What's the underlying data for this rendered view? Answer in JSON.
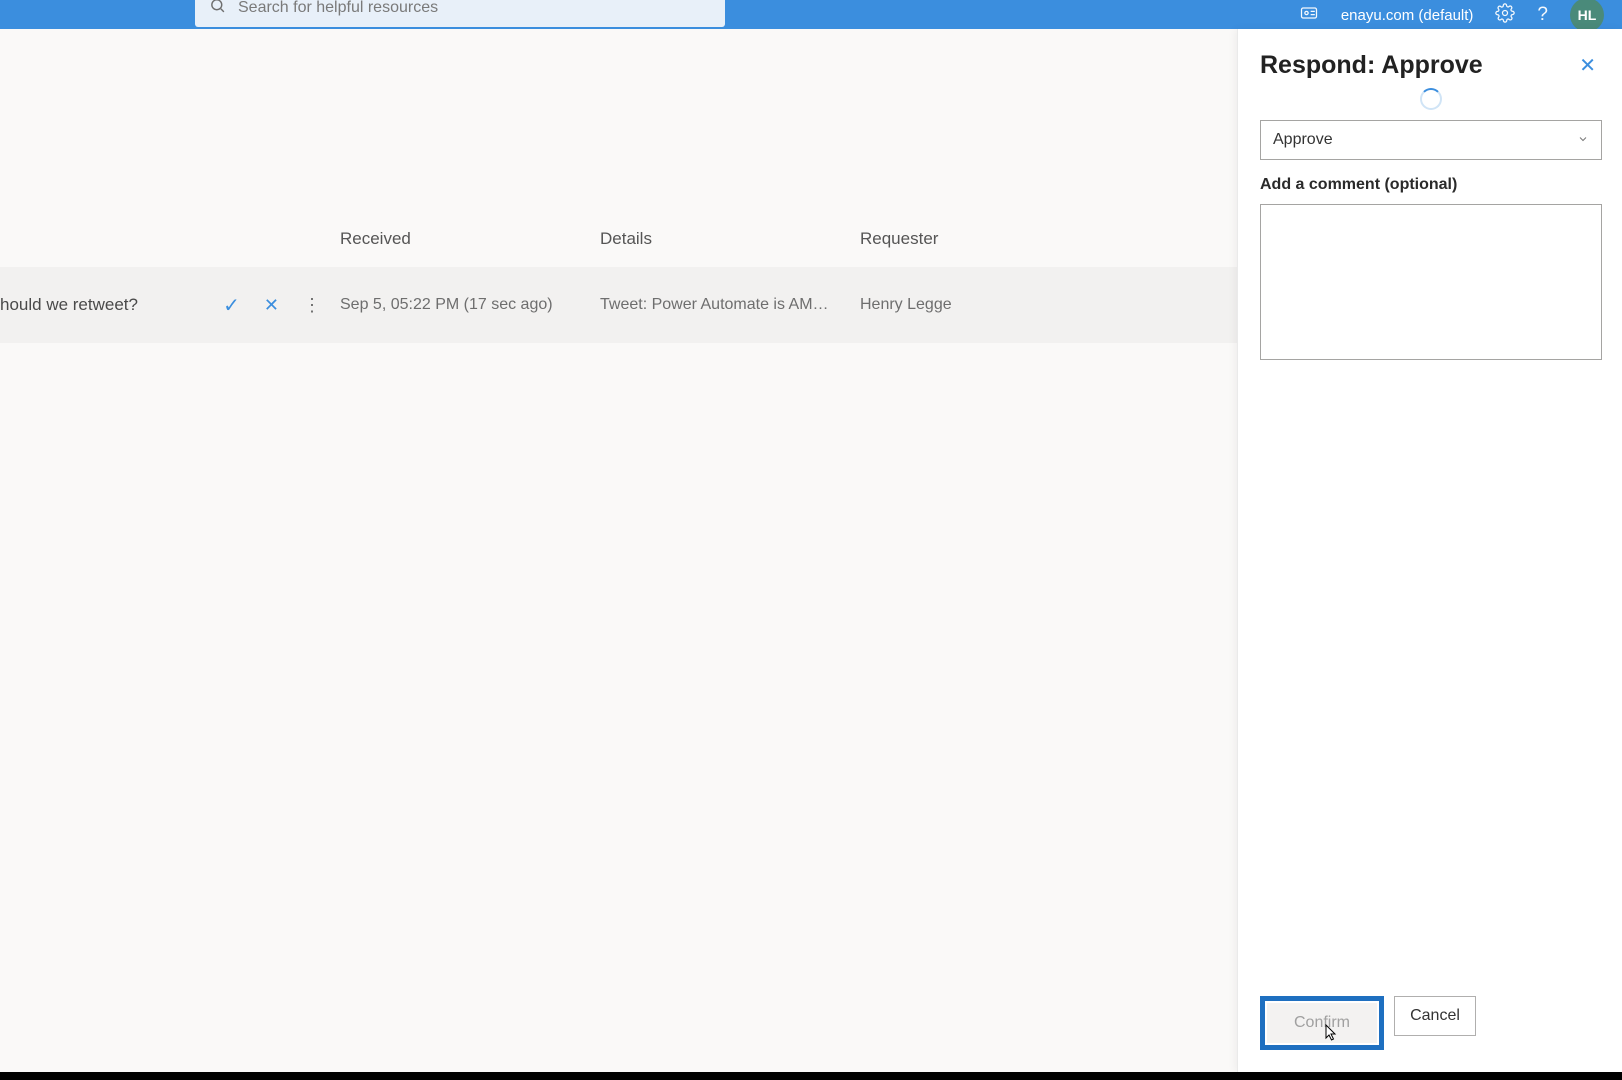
{
  "header": {
    "search_placeholder": "Search for helpful resources",
    "environment": "enayu.com (default)",
    "avatar_initials": "HL"
  },
  "list": {
    "columns": {
      "received": "Received",
      "details": "Details",
      "requester": "Requester"
    },
    "row": {
      "title": "hould we retweet?",
      "received": "Sep 5, 05:22 PM (17 sec ago)",
      "details": "Tweet: Power Automate is AMAZEBA...",
      "requester": "Henry Legge"
    }
  },
  "panel": {
    "title": "Respond: Approve",
    "select_value": "Approve",
    "comment_label": "Add a comment (optional)",
    "confirm_label": "Confirm",
    "cancel_label": "Cancel"
  }
}
